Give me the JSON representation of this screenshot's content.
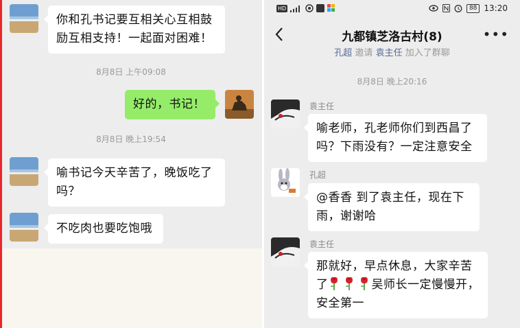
{
  "left": {
    "messages": [
      {
        "text": "你和孔书记要互相关心互相鼓励互相支持！一起面对困难！"
      },
      {
        "time": "8月8日 上午09:08"
      },
      {
        "text": "好的，书记！"
      },
      {
        "time": "8月8日 晚上19:54"
      },
      {
        "text": "喻书记今天辛苦了，晚饭吃了吗？"
      },
      {
        "text": "不吃肉也要吃饱哦"
      }
    ]
  },
  "right": {
    "status": {
      "time": "13:20",
      "battery": "88"
    },
    "header": {
      "title": "九都镇芝洛古村(8)"
    },
    "system_note": {
      "inviter": "孔超",
      "word": "邀请",
      "invitee": "袁主任",
      "tail": "加入了群聊"
    },
    "time1": "8月8日 晚上20:16",
    "messages": [
      {
        "sender": "袁主任",
        "text": "喻老师，孔老师你们到西昌了吗？下雨没有？一定注意安全"
      },
      {
        "sender": "孔超",
        "text": "@香香  到了袁主任，现在下雨，谢谢哈"
      },
      {
        "sender": "袁主任",
        "text_a": "那就好，早点休息，大家辛苦了",
        "text_b": "吴师长一定慢慢开，安全第一"
      }
    ]
  },
  "colors": {
    "sent_bubble": "#95ec69",
    "received_bubble": "#ffffff",
    "background": "#ededed",
    "link": "#576b95"
  },
  "icons": [
    "back-arrow-icon",
    "more-icon",
    "rose-emoji-icon"
  ]
}
